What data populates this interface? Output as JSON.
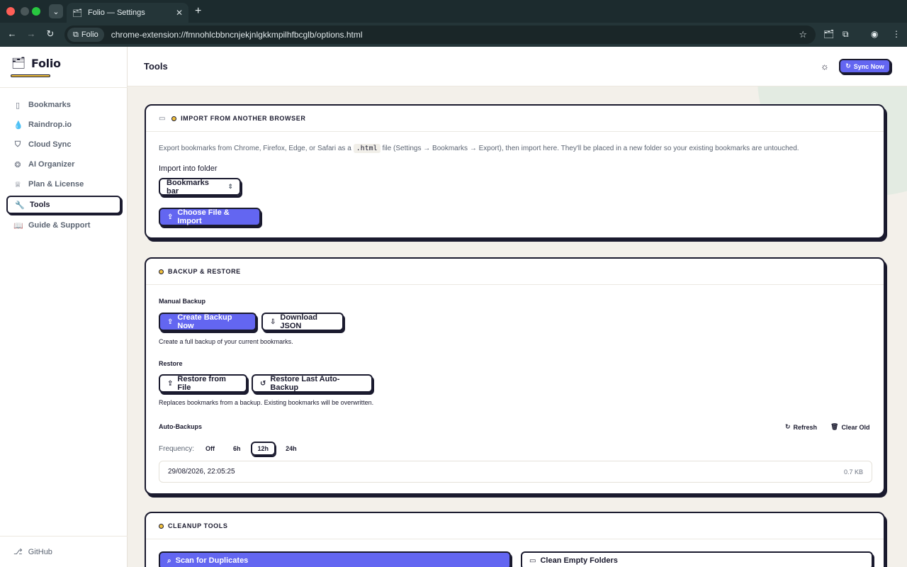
{
  "browser": {
    "tab_title": "Folio — Settings",
    "tab_close": "✕",
    "new_tab": "+",
    "omnibox_chip": "Folio",
    "url": "chrome-extension://fmnohlcbbncnjekjnlgkkmpilhfbcglb/options.html"
  },
  "brand": {
    "name": "Folio"
  },
  "sidebar": {
    "items": [
      {
        "label": "Bookmarks",
        "icon": "bookmark-icon"
      },
      {
        "label": "Raindrop.io",
        "icon": "droplet-icon"
      },
      {
        "label": "Cloud Sync",
        "icon": "shield-icon"
      },
      {
        "label": "AI Organizer",
        "icon": "brain-icon"
      },
      {
        "label": "Plan & License",
        "icon": "crown-icon"
      },
      {
        "label": "Tools",
        "icon": "wrench-icon",
        "active": true
      },
      {
        "label": "Guide & Support",
        "icon": "book-icon"
      }
    ],
    "footer": "GitHub"
  },
  "header": {
    "title": "Tools",
    "sync_label": "Sync Now"
  },
  "import": {
    "heading": "IMPORT FROM ANOTHER BROWSER",
    "desc_before": "Export bookmarks from Chrome, Firefox, Edge, or Safari as a",
    "desc_code": ".html",
    "desc_after": "file (Settings → Bookmarks → Export), then import here. They'll be placed in a new folder so your existing bookmarks are untouched.",
    "folder_label": "Import into folder",
    "folder_value": "Bookmarks bar",
    "import_button": "Choose File & Import"
  },
  "backup": {
    "heading": "BACKUP & RESTORE",
    "manual_label": "Manual Backup",
    "create_button": "Create Backup Now",
    "download_button": "Download JSON",
    "manual_desc": "Create a full backup of your current bookmarks.",
    "restore_label": "Restore",
    "restore_file_button": "Restore from File",
    "restore_last_button": "Restore Last Auto-Backup",
    "restore_desc": "Replaces bookmarks from a backup. Existing bookmarks will be overwritten.",
    "auto_label": "Auto-Backups",
    "refresh": "Refresh",
    "clear_old": "Clear Old",
    "frequency_label": "Frequency:",
    "frequency_options": [
      "Off",
      "6h",
      "12h",
      "24h"
    ],
    "frequency_selected": "12h",
    "entries": [
      {
        "date": "29/08/2026, 22:05:25",
        "size": "0.7 KB"
      }
    ]
  },
  "cleanup": {
    "heading": "CLEANUP TOOLS",
    "scan_button": "Scan for Duplicates",
    "clean_button": "Clean Empty Folders"
  },
  "colors": {
    "accent": "#6366f1",
    "ink": "#1a1a2e",
    "highlight": "#f3c23d",
    "page_bg": "#f3f0ea"
  }
}
